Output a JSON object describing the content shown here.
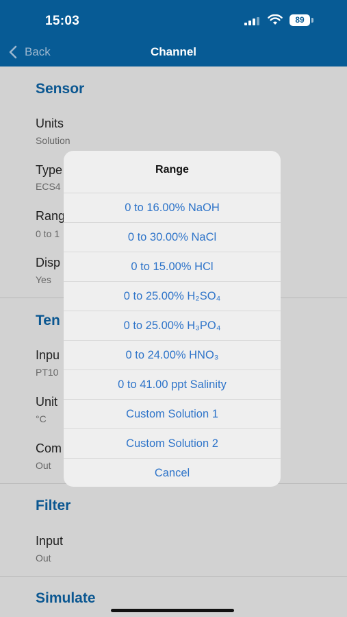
{
  "status": {
    "time": "15:03",
    "battery": "89"
  },
  "nav": {
    "back_label": "Back",
    "title": "Channel"
  },
  "sensor": {
    "title": "Sensor",
    "rows": [
      {
        "label": "Units",
        "value": "Solution"
      },
      {
        "label": "Type",
        "value": "ECS4"
      },
      {
        "label": "Rang",
        "value": "0 to 1"
      },
      {
        "label": "Disp",
        "value": "Yes"
      }
    ]
  },
  "temperature": {
    "title": "Ten",
    "rows": [
      {
        "label": "Inpu",
        "value": "PT10"
      },
      {
        "label": "Unit",
        "value": "°C"
      },
      {
        "label": "Com",
        "value": "Out"
      }
    ]
  },
  "filter": {
    "title": "Filter",
    "rows": [
      {
        "label": "Input",
        "value": "Out"
      }
    ]
  },
  "simulate": {
    "title": "Simulate"
  },
  "dialog": {
    "title": "Range",
    "options": [
      "0 to 16.00% NaOH",
      "0 to 30.00% NaCl",
      "0 to 15.00% HCl",
      "0 to 25.00% H₂SO₄",
      "0 to 25.00% H₃PO₄",
      "0 to 24.00% HNO₃",
      "0 to 41.00 ppt Salinity",
      "Custom Solution 1",
      "Custom Solution 2"
    ],
    "cancel_label": "Cancel"
  }
}
